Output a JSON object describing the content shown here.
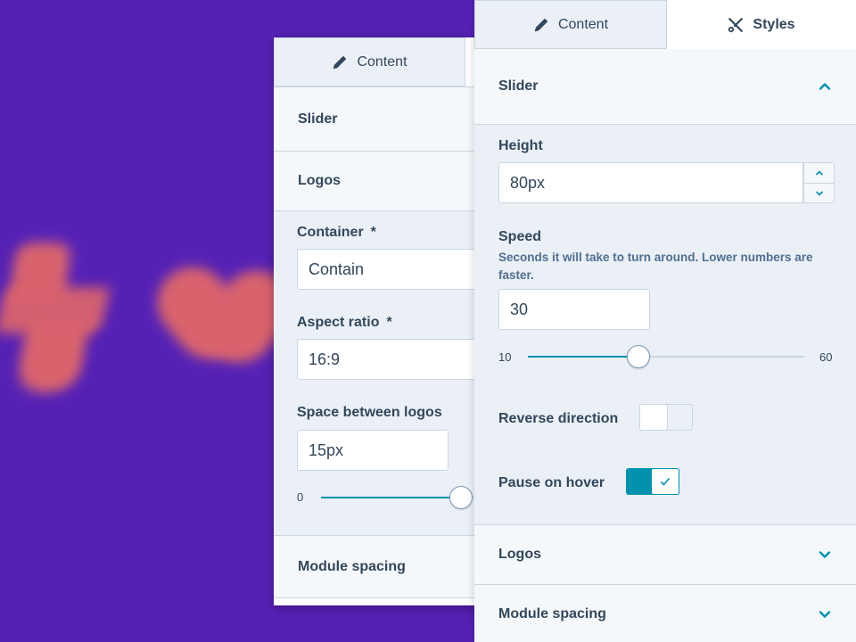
{
  "back_panel": {
    "tab_content_label": "Content",
    "sections": {
      "slider": "Slider",
      "logos": "Logos",
      "module_spacing": "Module spacing"
    },
    "fields": {
      "container_label": "Container",
      "container_value": "Contain",
      "aspect_ratio_label": "Aspect ratio",
      "aspect_ratio_value": "16:9",
      "space_label": "Space between logos",
      "space_value": "15px",
      "space_min": "0",
      "required_marker": "*"
    }
  },
  "front_panel": {
    "tabs": {
      "content": "Content",
      "styles": "Styles"
    },
    "slider_section": {
      "title": "Slider",
      "height_label": "Height",
      "height_value": "80px",
      "speed_label": "Speed",
      "speed_help": "Seconds it will take to turn around. Lower numbers are faster.",
      "speed_value": "30",
      "range_min": "10",
      "range_max": "60",
      "reverse_label": "Reverse direction",
      "reverse_on": false,
      "pause_label": "Pause on hover",
      "pause_on": true
    },
    "logos_title": "Logos",
    "module_spacing_title": "Module spacing"
  },
  "colors": {
    "background": "#5521b5",
    "accent": "#0091ae",
    "shape": "#d9636d"
  },
  "icons": {
    "content_tab": "pencil-icon",
    "styles_tab": "scissors-icon",
    "expanded": "chevron-up-icon",
    "collapsed": "chevron-down-icon",
    "toggle_on": "check-icon"
  }
}
